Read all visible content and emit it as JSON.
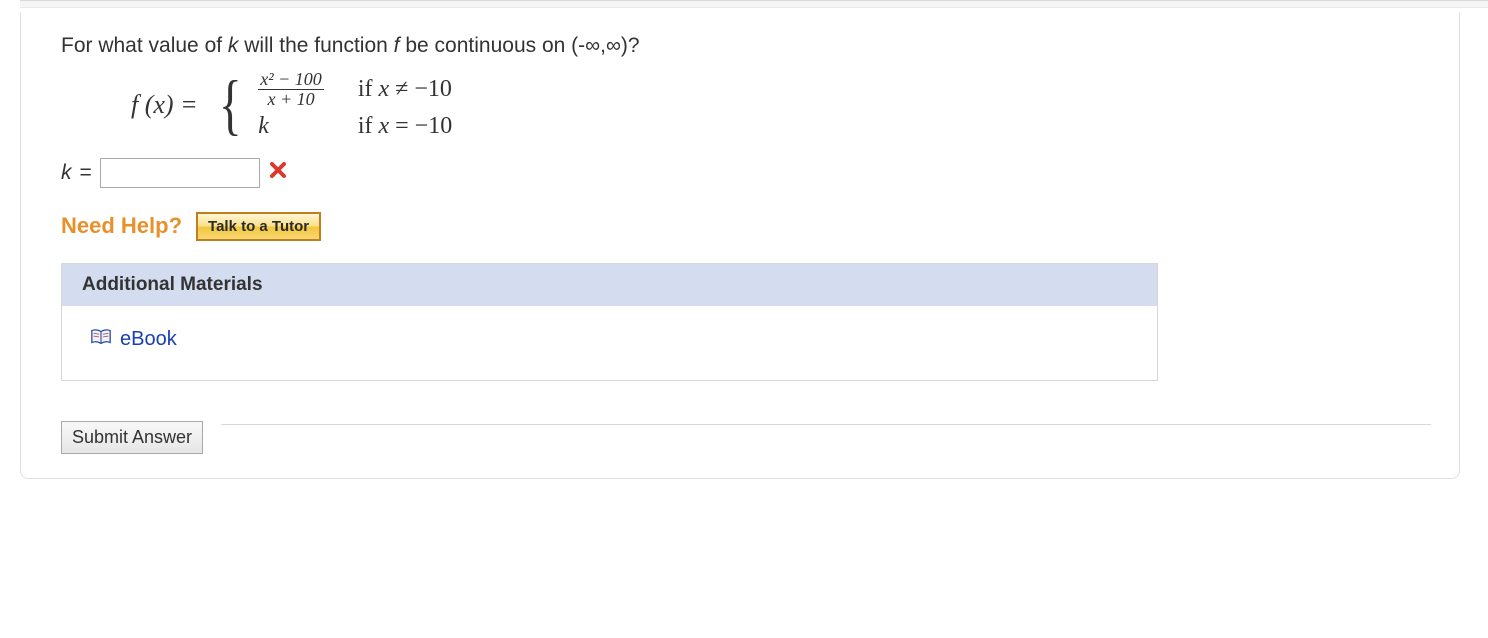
{
  "question": {
    "prefix": "For what value of ",
    "var_k": "k",
    "mid1": " will the function ",
    "var_f": "f",
    "mid2": " be continuous on ",
    "interval": "(-∞,∞)",
    "suffix": "?"
  },
  "formula": {
    "lhs": "f (x) = ",
    "case1_num": "x² − 100",
    "case1_den": "x + 10",
    "case1_cond_prefix": "if ",
    "case1_cond_rel": " ≠ −10",
    "case2_val": "k",
    "case2_cond_prefix": "if ",
    "case2_cond_rel": " = −10",
    "x": "x"
  },
  "answer": {
    "label_k": "k",
    "equals": " = ",
    "value": "",
    "status": "incorrect"
  },
  "help": {
    "label": "Need Help?",
    "tutor_button": "Talk to a Tutor"
  },
  "materials": {
    "heading": "Additional Materials",
    "ebook_label": "eBook"
  },
  "submit": {
    "label": "Submit Answer"
  }
}
